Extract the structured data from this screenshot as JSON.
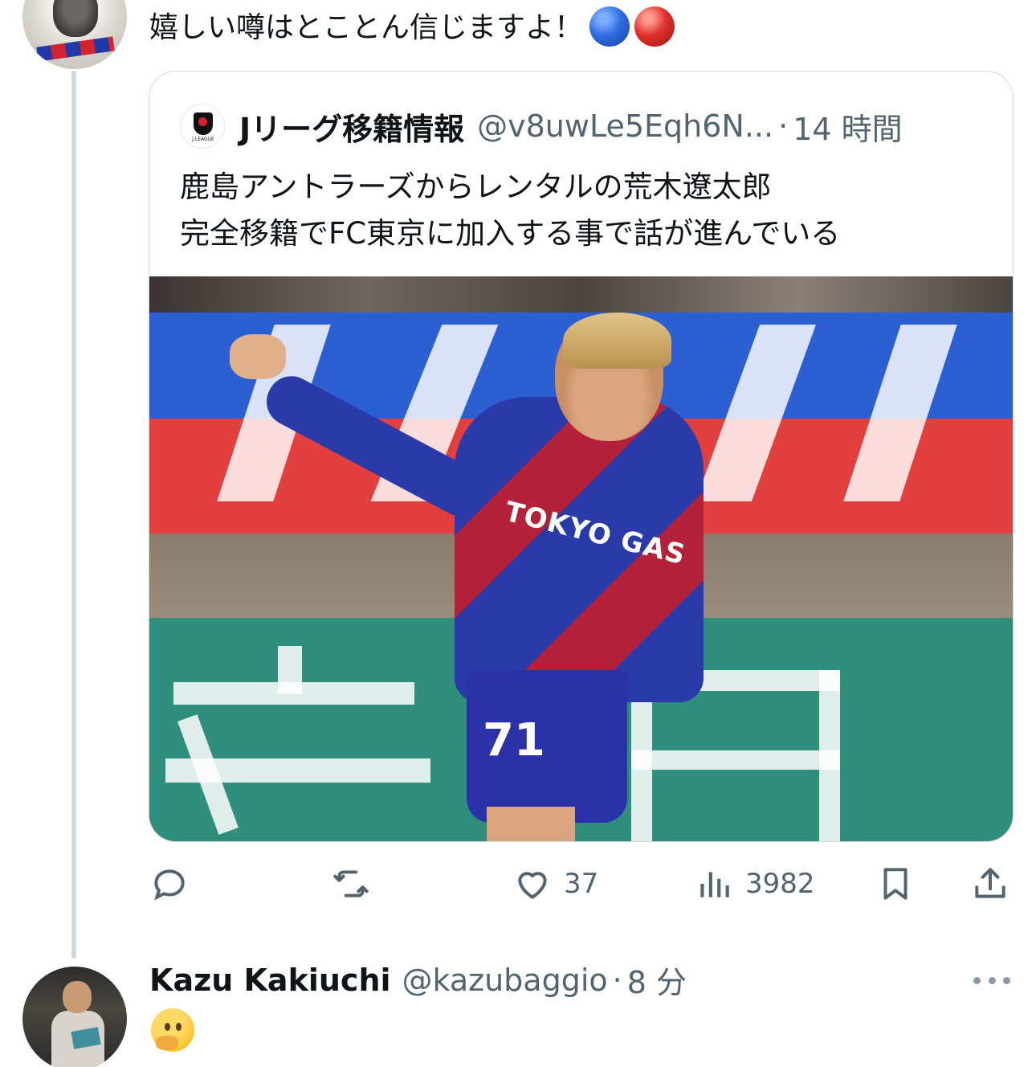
{
  "top_tweet": {
    "text": "嬉しい噂はとことん信じますよ！",
    "emojis": [
      "blue-circle",
      "red-circle"
    ]
  },
  "quote": {
    "account_name": "Jリーグ移籍情報",
    "handle": "@v8uwLe5Eqh6N...",
    "separator": "·",
    "time": "14 時間",
    "logo_text": "J.LEAGUE",
    "body_line1": "鹿島アントラーズからレンタルの荒木遼太郎",
    "body_line2": "完全移籍でFC東京に加入する事で話が進んでいる",
    "photo": {
      "sponsor": "TOKYO GAS",
      "shirt_number": "71"
    }
  },
  "actions": {
    "likes": "37",
    "views": "3982"
  },
  "reply": {
    "name": "Kazu Kakiuchi",
    "handle": "@kazubaggio",
    "separator": "·",
    "time": "8 分",
    "emoji": "thinking-face"
  },
  "colors": {
    "text": "#0f1419",
    "muted": "#536471",
    "border": "#cfd9de"
  }
}
